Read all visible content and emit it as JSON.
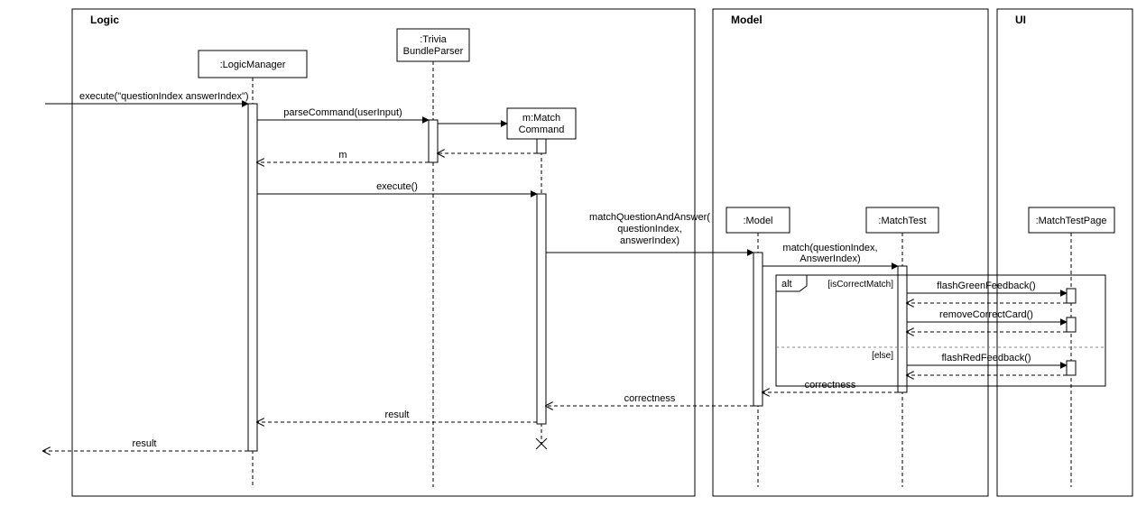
{
  "frames": {
    "logic": {
      "title": "Logic"
    },
    "model": {
      "title": "Model"
    },
    "ui": {
      "title": "UI"
    }
  },
  "participants": {
    "logicManager": {
      "label": ":LogicManager"
    },
    "triviaParser": {
      "label": ":Trivia\nBundleParser"
    },
    "matchCommand": {
      "label": "m:Match\nCommand"
    },
    "model": {
      "label": ":Model"
    },
    "matchTest": {
      "label": ":MatchTest"
    },
    "matchTestPage": {
      "label": ":MatchTestPage"
    }
  },
  "messages": {
    "executeIn": "execute(\"questionIndex answerIndex\")",
    "parseCommand": "parseCommand(userInput)",
    "returnM": "m",
    "executeCall": "execute()",
    "matchQA": "matchQuestionAndAnswer(\nquestionIndex,\nanswerIndex)",
    "matchCall": "match(questionIndex,\nAnswerIndex)",
    "flashGreen": "flashGreenFeedback()",
    "removeCard": "removeCorrectCard()",
    "flashRed": "flashRedFeedback()",
    "correctness1": "correctness",
    "correctness2": "correctness",
    "resultUp": "result",
    "resultOut": "result"
  },
  "alt": {
    "label": "alt",
    "guard1": "[isCorrectMatch]",
    "guard2": "[else]"
  }
}
